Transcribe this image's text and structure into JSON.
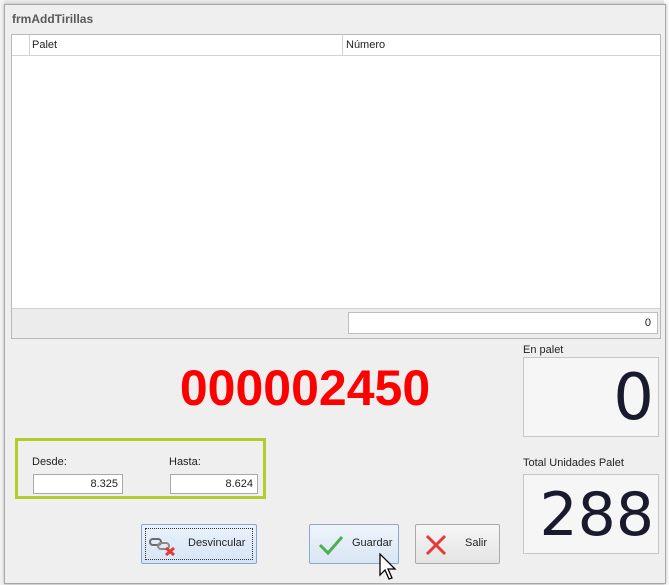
{
  "window": {
    "title": "frmAddTirillas"
  },
  "grid": {
    "columns": [
      "Palet",
      "Número"
    ],
    "rows": [],
    "footer_total": "0"
  },
  "main": {
    "big_number": "000002450"
  },
  "en_palet": {
    "label": "En palet",
    "value": "0"
  },
  "total_unidades": {
    "label": "Total Unidades Palet",
    "value": "288"
  },
  "range": {
    "desde_label": "Desde:",
    "desde_value": "8.325",
    "hasta_label": "Hasta:",
    "hasta_value": "8.624"
  },
  "buttons": {
    "desvincular": "Desvincular",
    "guardar": "Guardar",
    "salir": "Salir"
  },
  "icons": [
    "unlink-icon",
    "check-icon",
    "close-x-icon",
    "mouse-pointer-icon"
  ],
  "colors": {
    "big_number": "#ff0000",
    "range_border": "#b4cc2a",
    "check": "#4caf50",
    "close_x": "#e53935"
  }
}
